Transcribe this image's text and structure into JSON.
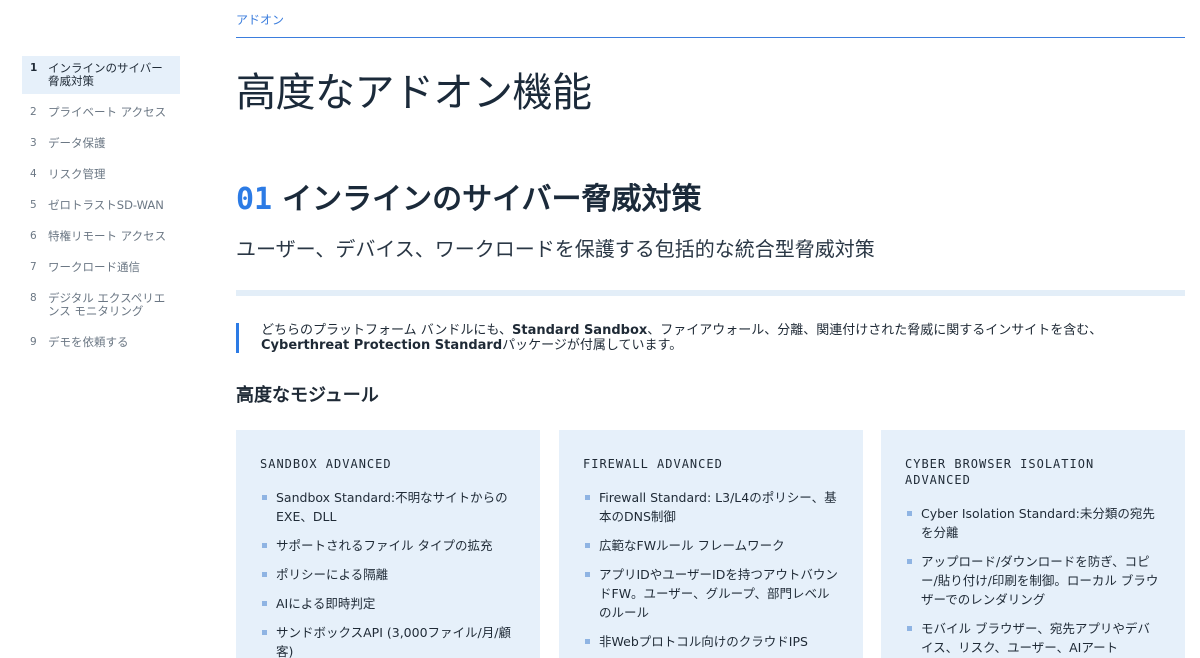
{
  "breadcrumb": "アドオン",
  "page_title": "高度なアドオン機能",
  "sidebar": {
    "items": [
      {
        "num": "1",
        "label": "インラインのサイバー脅威対策",
        "active": true
      },
      {
        "num": "2",
        "label": "プライベート アクセス"
      },
      {
        "num": "3",
        "label": "データ保護"
      },
      {
        "num": "4",
        "label": "リスク管理"
      },
      {
        "num": "5",
        "label": "ゼロトラストSD-WAN"
      },
      {
        "num": "6",
        "label": "特権リモート アクセス"
      },
      {
        "num": "7",
        "label": "ワークロード通信"
      },
      {
        "num": "8",
        "label": "デジタル エクスペリエンス モニタリング"
      },
      {
        "num": "9",
        "label": "デモを依頼する"
      }
    ]
  },
  "section": {
    "number": "01",
    "title": "インラインのサイバー脅威対策",
    "subtitle": "ユーザー、デバイス、ワークロードを保護する包括的な統合型脅威対策"
  },
  "callout": {
    "part1": "どちらのプラットフォーム バンドルにも、",
    "bold1": "Standard Sandbox",
    "part2": "、ファイアウォール、分離、関連付けされた脅威に関するインサイトを含む、",
    "bold2": "Cyberthreat Protection Standard",
    "part3": "パッケージが付属しています。"
  },
  "modules_title": "高度なモジュール",
  "cards": [
    {
      "title": "SANDBOX ADVANCED",
      "items": [
        "Sandbox Standard:不明なサイトからのEXE、DLL",
        "サポートされるファイル タイプの拡充",
        "ポリシーによる隔離",
        "AIによる即時判定",
        "サンドボックスAPI (3,000ファイル/月/顧客)"
      ]
    },
    {
      "title": "FIREWALL ADVANCED",
      "items": [
        "Firewall Standard: L3/L4のポリシー、基本のDNS制御",
        "広範なFWルール フレームワーク",
        "アプリIDやユーザーIDを持つアウトバウンドFW。ユーザー、グループ、部門レベルのルール",
        "非Webプロトコル向けのクラウドIPS"
      ]
    },
    {
      "title": "CYBER BROWSER ISOLATION ADVANCED",
      "items": [
        "Cyber Isolation Standard:未分類の宛先を分離",
        "アップロード/ダウンロードを防ぎ、コピー/貼り付け/印刷を制御。ローカル ブラウザーでのレンダリング",
        "モバイル ブラウザー、宛先アプリやデバイス、リスク、ユーザー、AIアート"
      ]
    }
  ],
  "colors": {
    "accent": "#2c7be5",
    "card_bg": "#e6f0fa",
    "active_bg": "#e6f0fa"
  }
}
